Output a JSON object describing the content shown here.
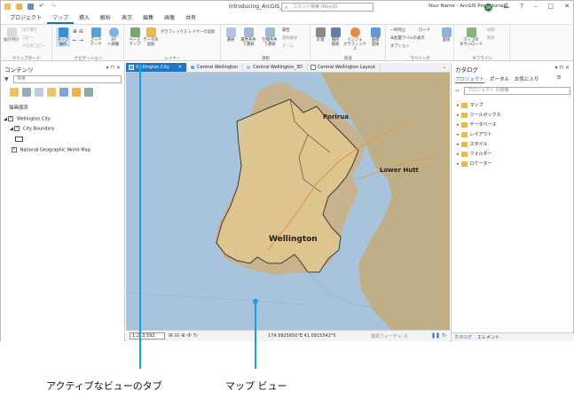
{
  "window": {
    "title": "Introducing_ArcGIS_Pro",
    "command_search_placeholder": "コマンド検索 (Alt+Q)",
    "user": "Your Name - ArcGIS Pro Tutorials",
    "avatar_initials": "YN",
    "controls": [
      "?",
      "–",
      "□",
      "✕"
    ]
  },
  "ribbon_tabs": [
    {
      "label": "プロジェクト",
      "active": false
    },
    {
      "label": "マップ",
      "active": true
    },
    {
      "label": "挿入",
      "active": false
    },
    {
      "label": "解析",
      "active": false
    },
    {
      "label": "表示",
      "active": false
    },
    {
      "label": "編集",
      "active": false
    },
    {
      "label": "画像",
      "active": false
    },
    {
      "label": "共有",
      "active": false
    }
  ],
  "ribbon": {
    "clipboard": {
      "name": "クリップボード",
      "paste": "貼り付け",
      "cut": "切り取り",
      "copy": "コピー",
      "copy_path": "パスのコピー"
    },
    "navigate": {
      "name": "ナビゲーション",
      "explore": "マップ\n操作",
      "bookmarks": "ブック\nマーク",
      "goto": "XY\nへ移動"
    },
    "layer": {
      "name": "レイヤー",
      "basemap": "ベース\nマップ",
      "add_data": "データの\n追加",
      "add_graphics": "グラフィックス レイヤーの追加"
    },
    "selection": {
      "name": "選択",
      "select": "選択",
      "by_attr": "属性条件\nで選択",
      "by_loc": "空間条件\nで選択",
      "attributes": "属性",
      "clear": "選択解除",
      "zoom": "ズーム"
    },
    "inquiry": {
      "name": "照会",
      "measure": "計測",
      "locate": "場所\n検索",
      "infographics": "インフォ\nグラフィックス",
      "coord": "座標\n変換"
    },
    "labeling": {
      "name": "ラベリング",
      "pause": "一時停止",
      "lock": "ロック",
      "unplaced": "未配置ラベルの表示",
      "more": "オプション",
      "convert": "変換"
    },
    "offline": {
      "name": "オフライン",
      "download": "マップの\nダウンロード",
      "sync": "同期",
      "remove": "削除"
    }
  },
  "contents_pane": {
    "title": "コンテンツ",
    "search_placeholder": "検索",
    "drawing_order": "描画順序",
    "items": [
      {
        "label": "Wellington City",
        "level": 0,
        "checked": true
      },
      {
        "label": "City Boundary",
        "level": 1,
        "checked": true
      },
      {
        "label": "National Geographic World Map",
        "level": 1,
        "checked": true
      }
    ]
  },
  "view_tabs": [
    {
      "label": "Wellington City",
      "active": true
    },
    {
      "label": "Central Wellington",
      "active": false
    },
    {
      "label": "Central Wellington_3D",
      "active": false
    },
    {
      "label": "Central Wellington Layout",
      "active": false
    }
  ],
  "map": {
    "labels": {
      "porirua": "Porirua",
      "lower_hutt": "Lower Hutt",
      "wellington": "Wellington"
    }
  },
  "status_bar": {
    "scale": "1:213,592",
    "coordinates": "174.9925650°E 41.0915542°S",
    "selected_features": "選択フィーチャ: 0"
  },
  "catalog_pane": {
    "title": "カタログ",
    "tabs": [
      {
        "label": "プロジェクト",
        "active": true
      },
      {
        "label": "ポータル",
        "active": false
      },
      {
        "label": "お気に入り",
        "active": false
      }
    ],
    "search_placeholder": "プロジェクト の検索",
    "items": [
      "マップ",
      "ツールボックス",
      "データベース",
      "レイアウト",
      "スタイル",
      "フォルダー",
      "ロケーター"
    ],
    "bottom_tabs": [
      {
        "label": "カタログ",
        "active": true
      },
      {
        "label": "エレメント",
        "active": false
      }
    ]
  },
  "callouts": {
    "active_tab": "アクティブなビューのタブ",
    "map_view": "マップ ビュー"
  },
  "colors": {
    "accent": "#1e74c6",
    "callout_line": "#1aa0e0",
    "water": "#a8c4dc",
    "land": "#c9b48c",
    "city": "#e9c98a"
  }
}
